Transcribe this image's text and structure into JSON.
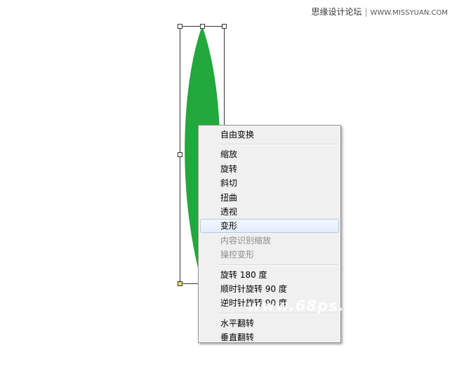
{
  "watermark": {
    "site_name": "思缘设计论坛",
    "site_url": "WWW.MISSYUAN.COM",
    "overlay_text": "www.68ps."
  },
  "colors": {
    "leaf": "#22a83c",
    "menu_bg": "#f0f0f0",
    "anchor_fill": "#e8e060"
  },
  "context_menu": {
    "groups": [
      {
        "items": [
          {
            "label": "自由变换",
            "enabled": true
          }
        ]
      },
      {
        "items": [
          {
            "label": "缩放",
            "enabled": true
          },
          {
            "label": "旋转",
            "enabled": true
          },
          {
            "label": "斜切",
            "enabled": true
          },
          {
            "label": "扭曲",
            "enabled": true
          },
          {
            "label": "透视",
            "enabled": true
          },
          {
            "label": "变形",
            "enabled": true,
            "highlighted": true
          },
          {
            "label": "内容识别缩放",
            "enabled": false
          },
          {
            "label": "操控变形",
            "enabled": false
          }
        ]
      },
      {
        "items": [
          {
            "label": "旋转 180 度",
            "enabled": true
          },
          {
            "label": "顺时针旋转 90 度",
            "enabled": true
          },
          {
            "label": "逆时针旋转 90 度",
            "enabled": true
          }
        ]
      },
      {
        "items": [
          {
            "label": "水平翻转",
            "enabled": true
          },
          {
            "label": "垂直翻转",
            "enabled": true
          }
        ]
      }
    ]
  }
}
